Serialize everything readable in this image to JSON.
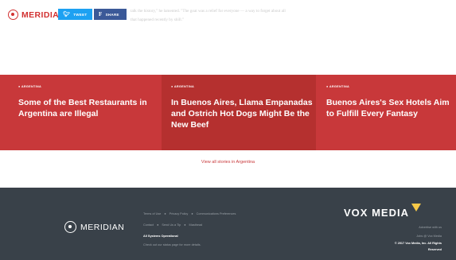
{
  "header": {
    "logo_text": "MERIDIAN",
    "twitter_label": "TWEET",
    "facebook_label": "SHARE",
    "faded_line_1": "talk the history,\" he lamented. \"The goat was a relief for everyone — a way to forget about all",
    "faded_line_2": "that happened recently by shill.\""
  },
  "stories": [
    {
      "kicker": "ARGENTINA",
      "headline": "Some of the Best Restaurants in Argentina are Illegal"
    },
    {
      "kicker": "ARGENTINA",
      "headline": "In Buenos Aires, Llama Empanadas and Ostrich Hot Dogs Might Be the New Beef"
    },
    {
      "kicker": "ARGENTINA",
      "headline": "Buenos Aires's Sex Hotels Aim to Fulfill Every Fantasy"
    }
  ],
  "view_all": "View all stories in Argentina",
  "footer": {
    "logo_text": "MERIDIAN",
    "links_row1": [
      "Terms of Use",
      "Privacy Policy",
      "Communications Preferences"
    ],
    "links_row2": [
      "Contact",
      "Send Us a Tip",
      "Masthead"
    ],
    "status": "All Systems Operational",
    "status_note": "Check out our status page for more details.",
    "brand": "VOX MEDIA",
    "advertise": "Advertise with us",
    "jobs": "Jobs @ Vox Media",
    "copyright_1": "© 2017 Vox Media, Inc. All Rights",
    "copyright_2": "Reserved"
  },
  "colors": {
    "accent": "#c8383a",
    "footer_bg": "#394149",
    "twitter": "#1da1f2",
    "facebook": "#3b5998"
  }
}
